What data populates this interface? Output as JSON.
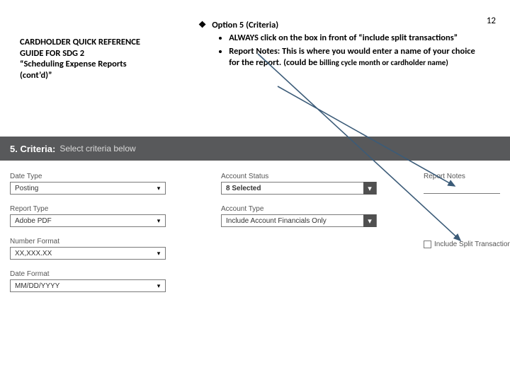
{
  "page_number": "12",
  "sidebar": {
    "line1": "CARDHOLDER QUICK REFERENCE",
    "line2": "GUIDE FOR SDG 2",
    "line3": "“Scheduling Expense Reports",
    "line4": "(cont’d)”"
  },
  "bullets": {
    "glyph": "❖",
    "head": "Option 5 (Criteria)",
    "item1": "ALWAYS click on the box in front of “include split transactions”",
    "item2_lead": "Report Notes:  This is where you would enter a name of your choice for the report.  (could be ",
    "item2_sub": "billing cycle month or cardholder name)"
  },
  "section": {
    "num": "5. Criteria:",
    "inst": "Select criteria below"
  },
  "fields": {
    "date_type": {
      "label": "Date Type",
      "value": "Posting"
    },
    "report_type": {
      "label": "Report Type",
      "value": "Adobe PDF"
    },
    "number_format": {
      "label": "Number Format",
      "value": "XX,XXX.XX"
    },
    "date_format": {
      "label": "Date Format",
      "value": "MM/DD/YYYY"
    },
    "account_status": {
      "label": "Account Status",
      "value": "8 Selected"
    },
    "account_type": {
      "label": "Account Type",
      "value": "Include Account Financials Only"
    },
    "report_notes": {
      "label": "Report Notes"
    },
    "include_split": {
      "label": "Include Split Transactions"
    }
  }
}
